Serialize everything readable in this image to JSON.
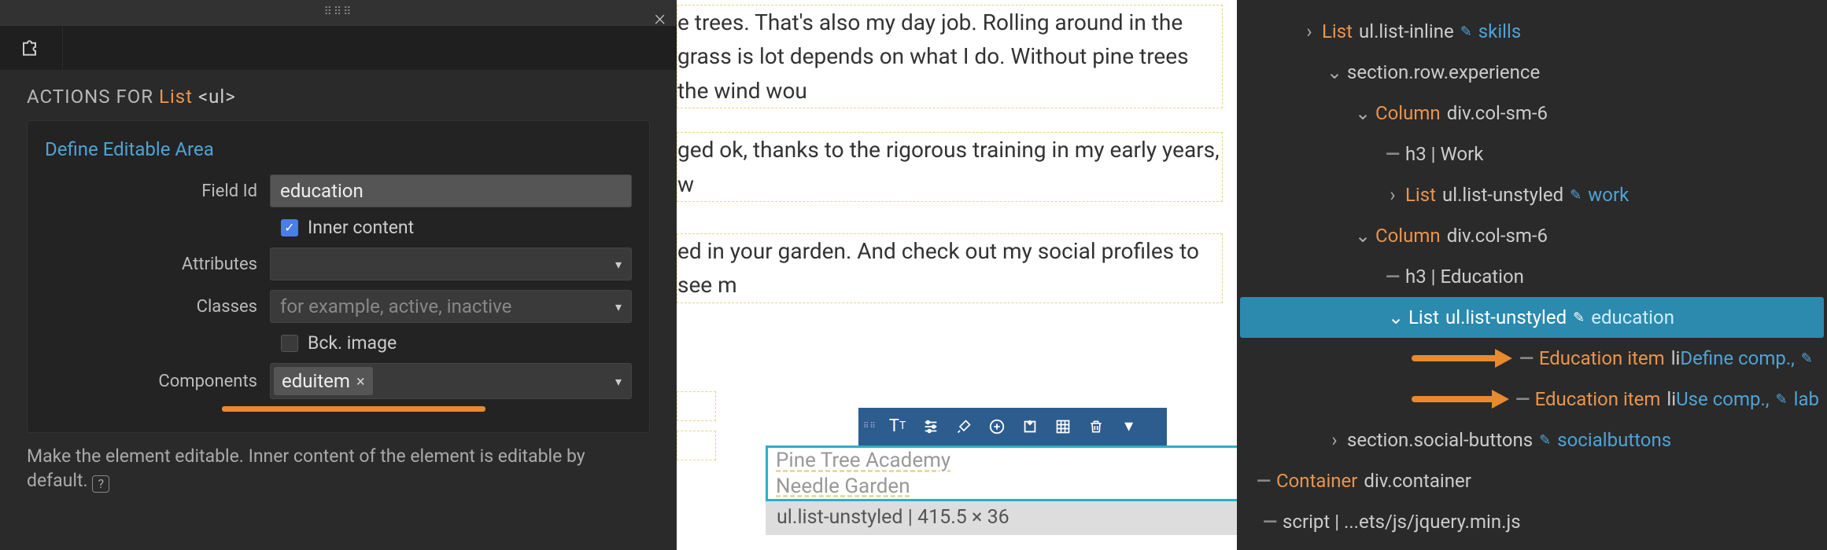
{
  "panel": {
    "heading_prefix": "ACTIONS FOR ",
    "element_name": "List",
    "element_tag": "<ul>",
    "section_title": "Define Editable Area",
    "labels": {
      "field_id": "Field Id",
      "attributes": "Attributes",
      "classes": "Classes",
      "components": "Components",
      "inner_content": "Inner content",
      "bck_image": "Bck. image"
    },
    "values": {
      "field_id": "education",
      "classes_placeholder": "for example, active, inactive"
    },
    "token": "eduitem",
    "help": "Make the element editable. Inner content of the element is editable by default."
  },
  "canvas": {
    "p1": "e trees. That's also my day job. Rolling around in the grass is lot depends on what I do. Without pine trees the wind wou",
    "p2": "ged ok, thanks to the rigorous training in my early years, w",
    "p3": "ed in your garden. And check out my social profiles to see m",
    "selected": {
      "line1": "Pine Tree Academy",
      "line2": "Needle Garden",
      "info": "ul.list-unstyled | 415.5 × 36"
    }
  },
  "tree": {
    "rows": [
      {
        "lvl": "ind0",
        "toggle": "›",
        "name": "List",
        "desc": "ul.list-inline",
        "link": "skills",
        "pen": true
      },
      {
        "lvl": "ind1",
        "toggle": "⌄",
        "name": "",
        "desc": "section.row.experience"
      },
      {
        "lvl": "ind2",
        "toggle": "⌄",
        "name": "Column",
        "desc": "div.col-sm-6"
      },
      {
        "lvl": "ind3",
        "dash": true,
        "name": "",
        "desc": "h3 | Work"
      },
      {
        "lvl": "ind3",
        "toggle": "›",
        "name": "List",
        "desc": "ul.list-unstyled",
        "link": "work",
        "pen": true
      },
      {
        "lvl": "ind2",
        "toggle": "⌄",
        "name": "Column",
        "desc": "div.col-sm-6"
      },
      {
        "lvl": "ind3",
        "dash": true,
        "name": "",
        "desc": "h3 | Education"
      },
      {
        "lvl": "ind3",
        "toggle": "⌄",
        "name": "List",
        "desc": "ul.list-unstyled",
        "link": "education",
        "pen": true,
        "selected": true
      },
      {
        "lvl": "ind4",
        "dash": true,
        "name": "Education item",
        "desc": "li",
        "link": "Define comp.,",
        "arrow": true,
        "trailpen": true
      },
      {
        "lvl": "ind4",
        "dash": true,
        "name": "Education item",
        "desc": "li",
        "link": "Use comp.,",
        "arrow": true,
        "trailpen": true,
        "traillink": "lab"
      },
      {
        "lvl": "ind1",
        "toggle": "›",
        "name": "",
        "desc": "section.social-buttons",
        "link": "socialbuttons",
        "pen": true
      },
      {
        "lvl": "indc",
        "dash": true,
        "name": "Container",
        "desc": "div.container"
      },
      {
        "lvl": "indd",
        "dash": true,
        "name": "",
        "desc": "script | ...ets/js/jquery.min.js"
      }
    ]
  }
}
